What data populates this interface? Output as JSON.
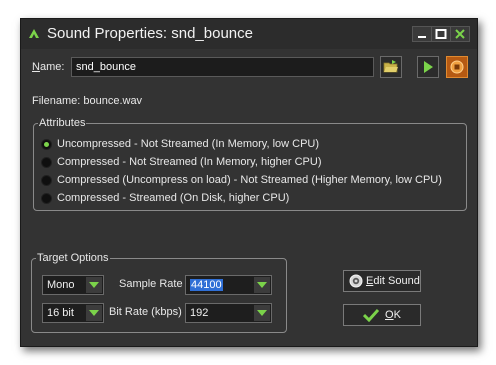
{
  "window": {
    "title": "Sound Properties: snd_bounce"
  },
  "name_row": {
    "label_accel": "N",
    "label_rest": "ame:",
    "value": "snd_bounce"
  },
  "filename": "Filename: bounce.wav",
  "attributes": {
    "legend": "Attributes",
    "options": [
      "Uncompressed - Not Streamed (In Memory, low CPU)",
      "Compressed - Not Streamed (In Memory, higher CPU)",
      "Compressed (Uncompress on load) - Not Streamed (Higher Memory, low CPU)",
      "Compressed - Streamed (On Disk, higher CPU)"
    ],
    "selected_index": 0
  },
  "target_options": {
    "legend": "Target Options",
    "channels": "Mono",
    "bit_depth": "16 bit",
    "sample_rate_label": "Sample Rate",
    "sample_rate": "44100",
    "bit_rate_label": "Bit Rate (kbps)",
    "bit_rate": "192"
  },
  "buttons": {
    "edit_accel": "E",
    "edit_rest": "dit Sound",
    "ok_accel": "O",
    "ok_rest": "K"
  },
  "colors": {
    "accent_green": "#7bd34a",
    "window_bg": "#333333",
    "selection_blue": "#2f6fd6"
  }
}
